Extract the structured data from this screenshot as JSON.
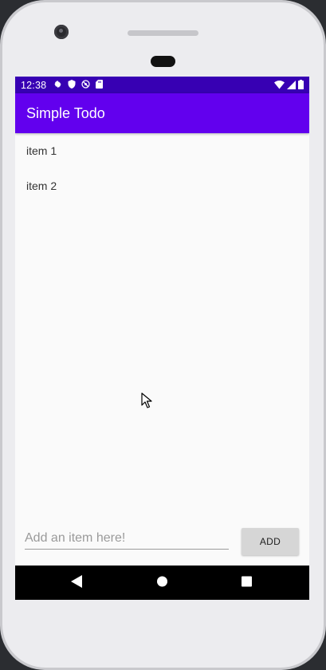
{
  "status_bar": {
    "time": "12:38",
    "icons_left": [
      "settings-icon",
      "shield-icon",
      "no-sim-icon",
      "sd-card-icon"
    ],
    "icons_right": [
      "wifi-icon",
      "signal-icon",
      "battery-icon"
    ]
  },
  "app_bar": {
    "title": "Simple Todo",
    "color": "#6200ee",
    "status_color": "#3700b3"
  },
  "todo_list": {
    "items": [
      {
        "label": "item 1"
      },
      {
        "label": "item 2"
      }
    ]
  },
  "input_area": {
    "placeholder": "Add an item here!",
    "value": "",
    "add_button_label": "ADD"
  },
  "nav_bar": {
    "buttons": [
      "back-icon",
      "home-icon",
      "recents-icon"
    ]
  }
}
